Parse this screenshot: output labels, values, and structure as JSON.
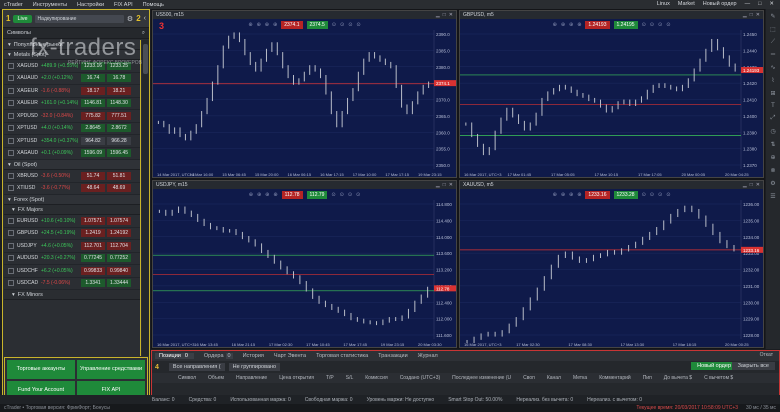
{
  "menubar": {
    "items": [
      "cTrader",
      "Инструменты",
      "Настройки",
      "FIX API",
      "Помощь"
    ],
    "right": [
      "Linux",
      "Market",
      "Новый ордер"
    ]
  },
  "leftpanel": {
    "live_label": "Live",
    "sorting_label": "Надкупирование",
    "search_label": "Символы",
    "groups": [
      {
        "label": "Популярные рынки",
        "type": "group"
      },
      {
        "label": "Metals (Spot)",
        "type": "group"
      },
      {
        "label": "XAGUSD",
        "type": "row",
        "chg": "+489.9 (+0.55%)",
        "bid": "1233.16",
        "ask": "1233.25",
        "dir": "up"
      },
      {
        "label": "XAUAUD",
        "type": "row",
        "chg": "+2.0 (+0.12%)",
        "bid": "16.74",
        "ask": "16.78",
        "dir": "up"
      },
      {
        "label": "XAGEUR",
        "type": "row",
        "chg": "-1.6 (-0.88%)",
        "bid": "18.17",
        "ask": "18.21",
        "dir": "dn"
      },
      {
        "label": "XAUEUR",
        "type": "row",
        "chg": "+161.0 (+0.14%)",
        "bid": "1146.81",
        "ask": "1148.30",
        "dir": "up"
      },
      {
        "label": "XPDUSD",
        "type": "row",
        "chg": "-32.0 (-0.84%)",
        "bid": "775.82",
        "ask": "777.51",
        "dir": "dn"
      },
      {
        "label": "XPTUSD",
        "type": "row",
        "chg": "+4.0 (+0.14%)",
        "bid": "2.8645",
        "ask": "2.8672",
        "dir": "up"
      },
      {
        "label": "XPTUSD",
        "type": "row",
        "chg": "+354.0 (+0.37%)",
        "bid": "964.82",
        "ask": "966.28",
        "dir": "nt"
      },
      {
        "label": "XAGAUD",
        "type": "row",
        "chg": "+0.1 (+0.09%)",
        "bid": "1596.09",
        "ask": "1596.45",
        "dir": "up"
      },
      {
        "label": "Oil (Spot)",
        "type": "group"
      },
      {
        "label": "XBRUSD",
        "type": "row",
        "chg": "-3.6 (-0.50%)",
        "bid": "51.74",
        "ask": "51.81",
        "dir": "dn"
      },
      {
        "label": "XTIUSD",
        "type": "row",
        "chg": "-3.6 (-0.77%)",
        "bid": "48.64",
        "ask": "48.69",
        "dir": "dn"
      },
      {
        "label": "Forex (Spot)",
        "type": "group"
      },
      {
        "label": "FX Majors",
        "type": "sub"
      },
      {
        "label": "EURUSD",
        "type": "row",
        "chg": "+10.6 (+0.10%)",
        "bid": "1.07571",
        "ask": "1.07574",
        "dir": "dn"
      },
      {
        "label": "GBPUSD",
        "type": "row",
        "chg": "+24.5 (+0.19%)",
        "bid": "1.2419",
        "ask": "1.24192",
        "dir": "dn"
      },
      {
        "label": "USDJPY",
        "type": "row",
        "chg": "+4.6 (+0.05%)",
        "bid": "112.701",
        "ask": "112.704",
        "dir": "dn"
      },
      {
        "label": "AUDUSD",
        "type": "row",
        "chg": "+20.3 (+0.27%)",
        "bid": "0.77245",
        "ask": "0.77252",
        "dir": "up"
      },
      {
        "label": "USDCHF",
        "type": "row",
        "chg": "+6.2 (+0.05%)",
        "bid": "0.99833",
        "ask": "0.99840",
        "dir": "dn"
      },
      {
        "label": "USDCAD",
        "type": "row",
        "chg": "-7.5 (-0.06%)",
        "bid": "1.3341",
        "ask": "1.33444",
        "dir": "up"
      },
      {
        "label": "FX Minors",
        "type": "sub"
      }
    ],
    "bottom_buttons": [
      "Торговые аккаунты",
      "Управление средствами",
      "Fund Your Account",
      "FIX API"
    ]
  },
  "watermark": {
    "logo_fx": "fx",
    "logo_traders": "-traders",
    "tagline": "РЕЙТИНГ ФОРЕКС БРОКЕРОВ"
  },
  "charts": [
    {
      "symbol": "US500, m15",
      "bid": "2374.1",
      "ask": "2374.5",
      "prices": [
        "2390.0",
        "2385.0",
        "2380.0",
        "2375.0",
        "2370.0",
        "2365.0",
        "2360.0",
        "2355.0",
        "2350.0"
      ],
      "dates": [
        "14 Mar 2017, UTC+3",
        "14 Mar 16:00",
        "15 Mar 06:45",
        "15 Mar 20:00",
        "16 Mar 06:15",
        "16 Mar 17:15",
        "17 Mar 10:00",
        "17 Mar 17:15",
        "19 Mar 23:15"
      ],
      "series": [
        2363,
        2362,
        2360,
        2361,
        2359,
        2358,
        2360,
        2362,
        2366,
        2370,
        2375,
        2380,
        2386,
        2389,
        2390,
        2388,
        2384,
        2381,
        2379,
        2382,
        2385,
        2387,
        2384,
        2380,
        2377,
        2375,
        2376,
        2378,
        2380,
        2379,
        2377,
        2372,
        2366,
        2362,
        2366,
        2370,
        2373,
        2378,
        2382,
        2384,
        2383,
        2382,
        2381,
        2380,
        2374,
        2368,
        2366,
        2369,
        2372,
        2374,
        2375
      ],
      "hlines": [
        {
          "v": 2374.8,
          "color": "#d83232"
        }
      ]
    },
    {
      "symbol": "GBPUSD, m5",
      "bid": "1.24193",
      "ask": "1.24195",
      "prices": [
        "1.2450",
        "1.2440",
        "1.2430",
        "1.2420",
        "1.2410",
        "1.2400",
        "1.2390",
        "1.2380",
        "1.2370"
      ],
      "dates": [
        "16 Mar 2017, UTC+3",
        "17 Mar 01:45",
        "17 Mar 05:05",
        "17 Mar 10:15",
        "17 Mar 17:05",
        "20 Mar 00:05",
        "20 Mar 04:25"
      ],
      "series": [
        1.2395,
        1.2388,
        1.2382,
        1.2377,
        1.238,
        1.239,
        1.2398,
        1.2404,
        1.24,
        1.2396,
        1.2392,
        1.2395,
        1.2401,
        1.241,
        1.2414,
        1.2416,
        1.2418,
        1.2417,
        1.2415,
        1.2413,
        1.2412,
        1.241,
        1.2409,
        1.2406,
        1.2403,
        1.2405,
        1.2408,
        1.2409,
        1.2407,
        1.2409,
        1.2411,
        1.2415,
        1.2418,
        1.2419,
        1.2418,
        1.2417,
        1.2416,
        1.2418,
        1.2422,
        1.2428,
        1.2434,
        1.244,
        1.2446,
        1.2441,
        1.2436,
        1.2431,
        1.2428
      ],
      "hlines": [
        {
          "v": 1.2425,
          "color": "#3cc85a"
        },
        {
          "v": 1.2407,
          "color": "#d83232"
        },
        {
          "v": 1.2388,
          "color": "#3cc85a"
        }
      ]
    },
    {
      "symbol": "USDJPY, m15",
      "bid": "112.78",
      "ask": "112.79",
      "prices": [
        "114.800",
        "114.400",
        "114.000",
        "113.600",
        "113.200",
        "112.800",
        "112.400",
        "112.000",
        "111.600"
      ],
      "dates": [
        "16 Mar 2017, UTC+3",
        "16 Mar 13:45",
        "16 Mar 21:15",
        "17 Mar 02:30",
        "17 Mar 10:45",
        "17 Mar 17:45",
        "19 Mar 23:15",
        "20 Mar 03:30"
      ],
      "series": [
        114.62,
        114.55,
        114.62,
        114.7,
        114.6,
        114.52,
        114.4,
        114.3,
        114.22,
        114.2,
        114.14,
        114.15,
        114.08,
        113.98,
        113.9,
        113.8,
        113.64,
        113.52,
        113.38,
        113.24,
        113.12,
        113.02,
        112.88,
        112.7,
        112.52,
        112.4,
        112.32,
        112.25,
        112.18,
        112.1,
        112.0,
        111.96,
        111.92,
        111.9,
        111.88,
        111.94,
        112.0,
        111.98,
        112.04,
        112.2,
        112.4,
        112.55,
        112.74
      ],
      "hlines": [
        {
          "v": 113.55,
          "color": "#3cc85a"
        },
        {
          "v": 113.08,
          "color": "#d83232"
        },
        {
          "v": 112.68,
          "color": "#3cc85a"
        }
      ]
    },
    {
      "symbol": "XAUUSD, m5",
      "bid": "1233.16",
      "ask": "1233.28",
      "prices": [
        "1236.00",
        "1235.00",
        "1234.00",
        "1233.00",
        "1232.00",
        "1231.00",
        "1230.00",
        "1229.00",
        "1228.00"
      ],
      "dates": [
        "16 Mar 2017, UTC+3",
        "17 Mar 02:30",
        "17 Mar 08:30",
        "17 Mar 13:30",
        "17 Mar 18:15",
        "20 Mar 00:25"
      ],
      "series": [
        1227.6,
        1227.8,
        1228.0,
        1228.1,
        1228.0,
        1228.2,
        1228.6,
        1229.0,
        1229.6,
        1230.2,
        1230.8,
        1231.5,
        1232.2,
        1232.8,
        1233.0,
        1232.7,
        1232.5,
        1232.6,
        1232.8,
        1232.9,
        1233.1,
        1233.0,
        1233.2,
        1233.4,
        1233.6,
        1233.9,
        1234.2,
        1234.5,
        1234.9,
        1235.3,
        1235.6,
        1235.8,
        1235.6,
        1235.2,
        1234.7,
        1234.2,
        1233.7,
        1233.4,
        1233.2
      ],
      "hlines": [
        {
          "v": 1233.2,
          "color": "#d83232"
        }
      ]
    }
  ],
  "righttb": [
    "✎",
    "⬚",
    "⟋",
    "═",
    "∿",
    "⌇",
    "⊞",
    "T",
    "⤢",
    "◷",
    "⇅",
    "⊕",
    "⊗",
    "⚙",
    "☰"
  ],
  "tradewatch": {
    "tabs": [
      {
        "label": "Позиции",
        "count": "0",
        "active": true
      },
      {
        "label": "Ордера",
        "count": "0"
      },
      {
        "label": "История"
      },
      {
        "label": "Чарт Эвента"
      },
      {
        "label": "Торговая статистика"
      },
      {
        "label": "Транзакции"
      },
      {
        "label": "Журнал"
      }
    ],
    "section_num": "4",
    "filter_all": "Все направления (",
    "filter_group": "Не группировано",
    "new_order": "Новый ордер",
    "close_all": "Закрыть все",
    "columns": [
      "Символ",
      "Объем",
      "Направление",
      "Цена открытия",
      "T/P",
      "S/L",
      "Комиссия",
      "Создано (UTC+3)",
      "Последнее изменение (U",
      "Своп",
      "Канал",
      "Метка",
      "Комментарий",
      "Пип",
      "До вычета $",
      "С вычетом $"
    ],
    "right_label": "Откат"
  },
  "acctbar": [
    "Баланс: 0",
    "Средства: 0",
    "Использованная маржа: 0",
    "Свободная маржа: 0",
    "Уровень маржи: Не доступно",
    "Smart Stop Out: 50.00%",
    "Нереализ. без вычета: 0",
    "Нереализ. с вычетом: 0"
  ],
  "statusbar": {
    "left": "cTrader • Торговая версия: ФрикФорт; Бонусы",
    "right": [
      "Текущее время: 20/03/2017 10:58:09 UTC+3",
      "30 мс / 35 мс"
    ]
  },
  "badges": {
    "one": "1",
    "two": "2",
    "three": "3",
    "four": "4"
  },
  "colors": {
    "chart_bg": "#0f1a4a",
    "up": "#3cc85a",
    "down": "#e04848",
    "accent_yellow": "#c9b42b"
  }
}
